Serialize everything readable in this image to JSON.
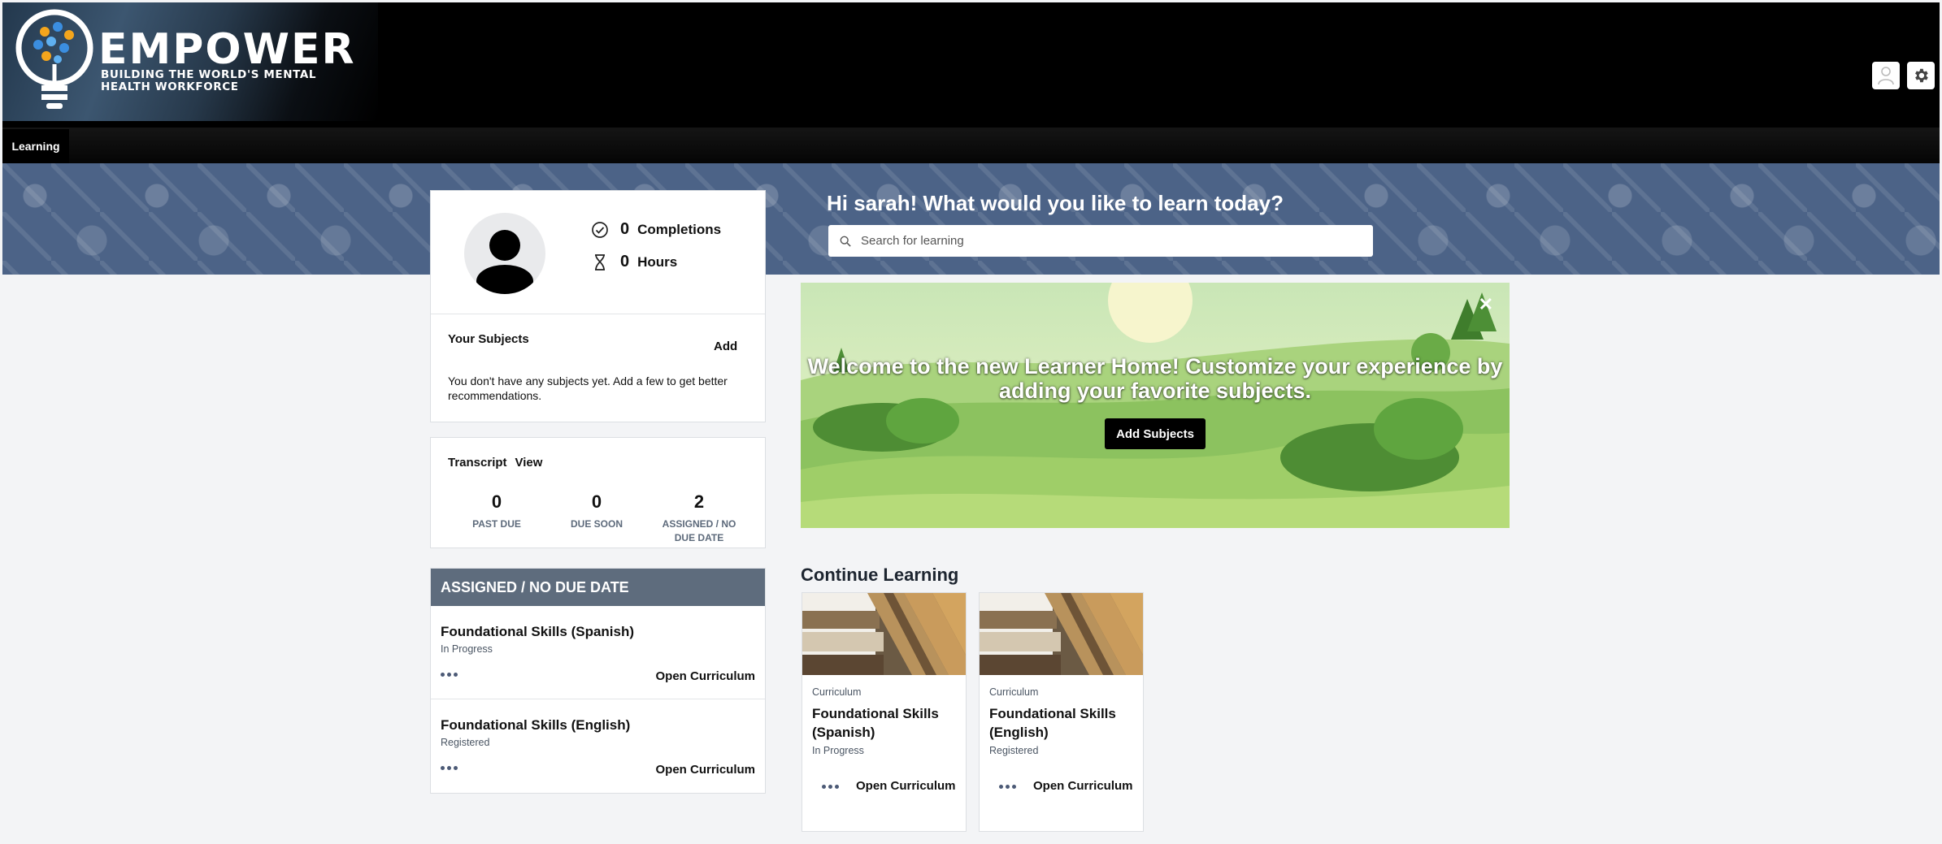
{
  "header": {
    "brand": "EMPOWER",
    "tagline": "BUILDING THE WORLD'S MENTAL HEALTH WORKFORCE",
    "icons": [
      "user-icon",
      "gear-icon"
    ]
  },
  "nav": {
    "tabs": [
      {
        "label": "Learning",
        "active": true
      }
    ]
  },
  "hero": {
    "greeting": "Hi sarah! What would you like to learn today?",
    "search_placeholder": "Search for learning"
  },
  "profile": {
    "completions_count": "0",
    "completions_label": "Completions",
    "hours_count": "0",
    "hours_label": "Hours",
    "subjects_title": "Your Subjects",
    "subjects_add": "Add",
    "subjects_empty": "You don't have any subjects yet. Add a few to get better recommendations."
  },
  "transcript": {
    "title": "Transcript",
    "view_link": "View",
    "stats": [
      {
        "value": "0",
        "label": "PAST DUE"
      },
      {
        "value": "0",
        "label": "DUE SOON"
      },
      {
        "value": "2",
        "label": "ASSIGNED / NO DUE DATE"
      }
    ]
  },
  "assigned": {
    "title": "ASSIGNED / NO DUE DATE",
    "items": [
      {
        "title": "Foundational Skills (Spanish)",
        "status": "In Progress",
        "action": "Open Curriculum"
      },
      {
        "title": "Foundational Skills (English)",
        "status": "Registered",
        "action": "Open Curriculum"
      }
    ]
  },
  "banner": {
    "text": "Welcome to the new Learner Home! Customize your experience by adding your favorite subjects.",
    "button": "Add Subjects"
  },
  "continue_learning": {
    "title": "Continue Learning",
    "cards": [
      {
        "type": "Curriculum",
        "title": "Foundational Skills (Spanish)",
        "status": "In Progress",
        "action": "Open Curriculum"
      },
      {
        "type": "Curriculum",
        "title": "Foundational Skills (English)",
        "status": "Registered",
        "action": "Open Curriculum"
      }
    ]
  },
  "colors": {
    "hero_bg": "#4c6387",
    "section_header": "#5e6c7d",
    "page_bg": "#f3f4f6"
  }
}
